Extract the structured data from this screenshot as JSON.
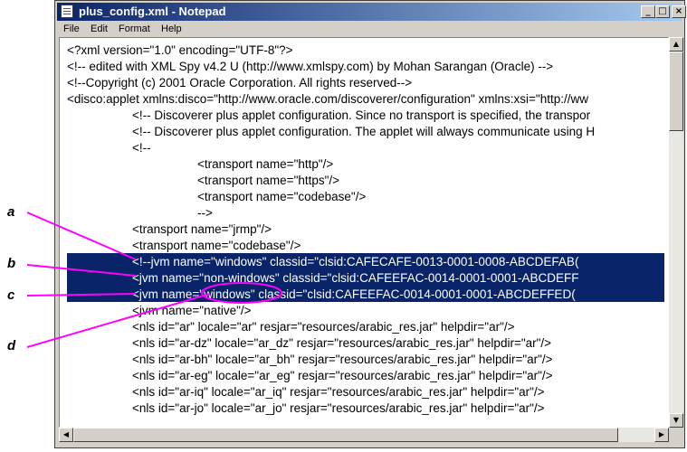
{
  "window": {
    "title": "plus_config.xml - Notepad",
    "buttons": {
      "minimize": "_",
      "maximize": "□",
      "close": "×"
    }
  },
  "menu": [
    "File",
    "Edit",
    "Format",
    "Help"
  ],
  "lines": [
    "<?xml version=\"1.0\" encoding=\"UTF-8\"?>",
    "<!-- edited with XML Spy v4.2 U (http://www.xmlspy.com) by Mohan Sarangan (Oracle) -->",
    "<!--Copyright (c) 2001 Oracle Corporation. All rights reserved-->",
    "<disco:applet xmlns:disco=\"http://www.oracle.com/discoverer/configuration\" xmlns:xsi=\"http://ww",
    "<!-- Discoverer plus applet configuration. Since no transport is specified, the transpor",
    "<!-- Discoverer plus applet configuration. The applet will always communicate using H",
    "<!--",
    "<transport name=\"http\"/>",
    "<transport name=\"https\"/>",
    "<transport name=\"codebase\"/>",
    "-->",
    "<transport name=\"jrmp\"/>",
    "<transport name=\"codebase\"/>",
    "<!--jvm name=\"windows\" classid=\"clsid:CAFECAFE-0013-0001-0008-ABCDEFAB(",
    "<jvm name=\"non-windows\" classid=\"clsid:CAFEEFAC-0014-0001-0001-ABCDEFF",
    "<jvm name=\"windows\" classid=\"clsid:CAFEEFAC-0014-0001-0001-ABCDEFFED(",
    "<jvm name=\"native\"/>",
    "<nls id=\"ar\" locale=\"ar\" resjar=\"resources/arabic_res.jar\" helpdir=\"ar\"/>",
    "<nls id=\"ar-dz\" locale=\"ar_dz\" resjar=\"resources/arabic_res.jar\" helpdir=\"ar\"/>",
    "<nls id=\"ar-bh\" locale=\"ar_bh\" resjar=\"resources/arabic_res.jar\" helpdir=\"ar\"/>",
    "<nls id=\"ar-eg\" locale=\"ar_eg\" resjar=\"resources/arabic_res.jar\" helpdir=\"ar\"/>",
    "<nls id=\"ar-iq\" locale=\"ar_iq\" resjar=\"resources/arabic_res.jar\" helpdir=\"ar\"/>",
    "<nls id=\"ar-jo\" locale=\"ar_jo\" resjar=\"resources/arabic_res.jar\" helpdir=\"ar\"/>"
  ],
  "callouts": [
    "a",
    "b",
    "c",
    "d"
  ],
  "colors": {
    "selection": "#0a246a",
    "callout": "#ff00ff",
    "titlebar": "#0a246a"
  }
}
